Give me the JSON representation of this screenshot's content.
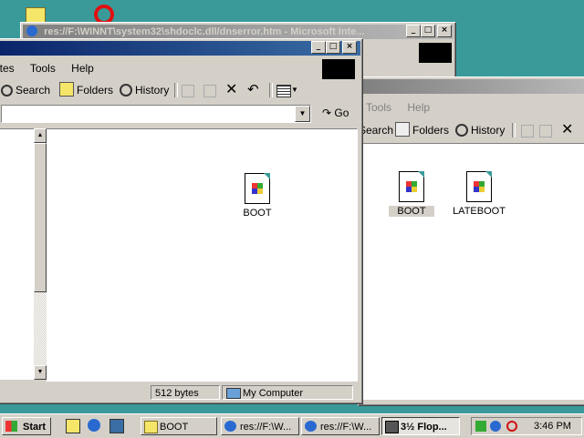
{
  "desktop": {
    "bg": "#3a9a9a"
  },
  "browser_window": {
    "title": "res://F:\\WINNT\\system32\\shdoclc.dll/dnserror.htm - Microsoft Inte...",
    "controls": [
      "_",
      "□",
      "×"
    ]
  },
  "back_window": {
    "menu": [
      "Tools",
      "Help"
    ],
    "toolbar": {
      "search": "Search",
      "folders": "Folders",
      "history": "History"
    },
    "files": [
      {
        "name": "BOOT",
        "selected": true
      },
      {
        "name": "LATEBOOT",
        "selected": false
      }
    ]
  },
  "front_window": {
    "controls": [
      "_",
      "□",
      "×"
    ],
    "menu": [
      "ites",
      "Tools",
      "Help"
    ],
    "toolbar": {
      "search": "Search",
      "folders": "Folders",
      "history": "History"
    },
    "go_label": "Go",
    "address_value": "",
    "files": [
      {
        "name": "BOOT"
      }
    ],
    "status": {
      "size": "512 bytes",
      "zone": "My Computer"
    }
  },
  "taskbar": {
    "start_label": "Start",
    "tasks": [
      {
        "label": "BOOT",
        "active": false
      },
      {
        "label": "res://F:\\W...",
        "active": false
      },
      {
        "label": "res://F:\\W...",
        "active": false
      },
      {
        "label": "3½ Flop...",
        "active": true
      }
    ],
    "clock": "3:46 PM"
  }
}
